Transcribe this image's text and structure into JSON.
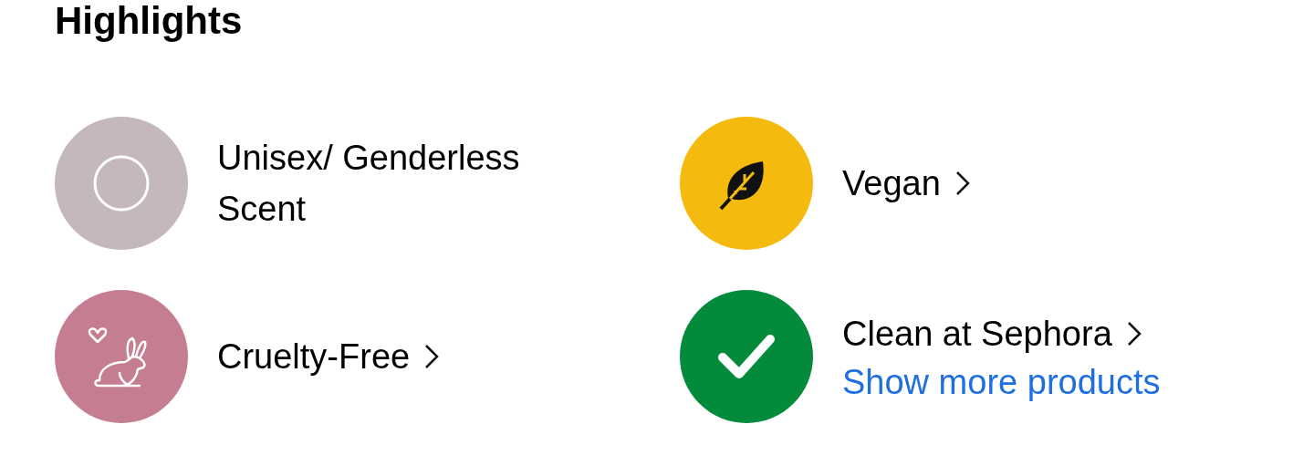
{
  "title": "Highlights",
  "items": [
    {
      "kind": "ring",
      "color": "#c4b8bd",
      "label": "Unisex/ Genderless Scent",
      "chevron": false
    },
    {
      "kind": "leaf",
      "color": "#f4bb0e",
      "label": "Vegan",
      "chevron": true
    },
    {
      "kind": "rabbit",
      "color": "#c57d91",
      "label": "Cruelty-Free",
      "chevron": true
    },
    {
      "kind": "check",
      "color": "#038a3a",
      "label": "Clean at Sephora",
      "chevron": true,
      "link": "Show more products"
    }
  ]
}
